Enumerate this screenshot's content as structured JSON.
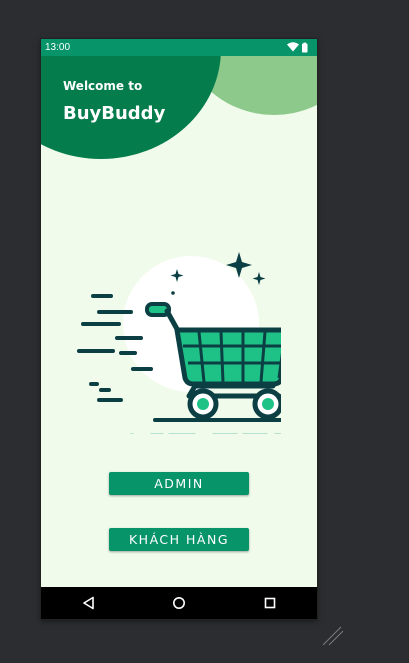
{
  "status_bar": {
    "time": "13:00",
    "icons": [
      "wifi-icon",
      "battery-icon"
    ]
  },
  "header": {
    "welcome_text": "Welcome to",
    "app_name": "BuyBuddy"
  },
  "illustration": {
    "name": "shopping-cart-illustration"
  },
  "buttons": {
    "admin_label": "ADMIN",
    "customer_label": "KHÁCH HÀNG"
  },
  "navigation_bar": {
    "items": [
      "back-icon",
      "home-icon",
      "recents-icon"
    ]
  },
  "colors": {
    "status_bar": "#079468",
    "header_dark": "#057c4c",
    "header_light": "#8cc98b",
    "background": "#f1fbec",
    "button": "#079468",
    "cart_green": "#1fc286",
    "cart_outline": "#0b3f44"
  }
}
